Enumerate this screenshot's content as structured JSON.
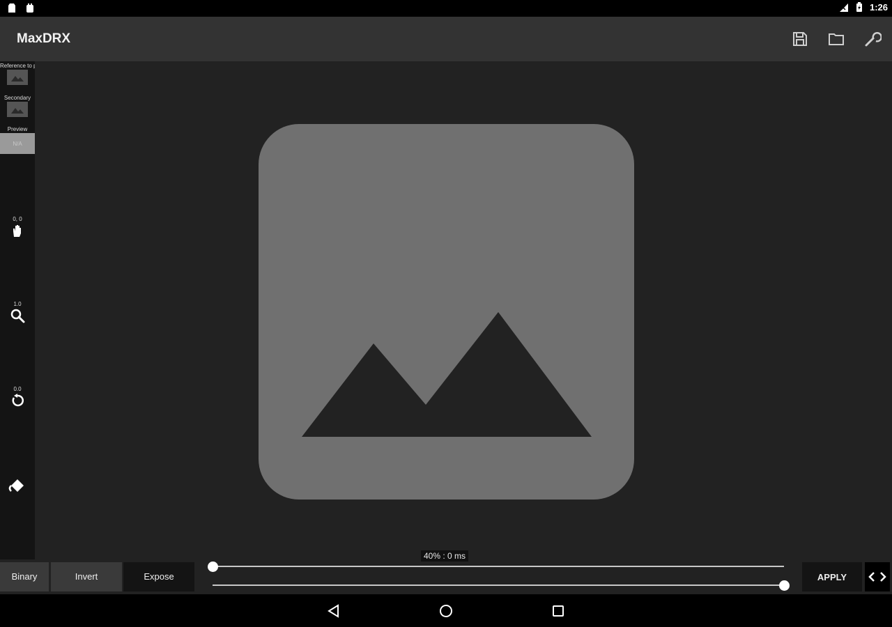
{
  "status_bar": {
    "time": "1:26",
    "icons": [
      "notification-icon",
      "android-icon",
      "signal-icon",
      "battery-icon"
    ]
  },
  "app_bar": {
    "title": "MaxDRX",
    "actions": [
      "save-icon",
      "folder-icon",
      "wrench-icon"
    ]
  },
  "left_rail": {
    "layers": [
      {
        "label": "Reference to primary"
      },
      {
        "label": "Secondary"
      },
      {
        "label": "Preview",
        "thumb_text": "N/A"
      }
    ],
    "tools": [
      {
        "icon": "hand-icon",
        "value": "0, 0"
      },
      {
        "icon": "zoom-icon",
        "value": "1.0"
      },
      {
        "icon": "rotate-icon",
        "value": "0.0"
      },
      {
        "icon": "fill-icon",
        "value": ""
      }
    ]
  },
  "canvas": {
    "placeholder_icon": "image-placeholder-icon",
    "colors": {
      "background": "#222222",
      "placeholder": "#707070"
    }
  },
  "controls": {
    "modes": [
      "Binary",
      "Invert",
      "Expose"
    ],
    "slider_label": "40% : 0 ms",
    "slider_top_value": 0,
    "slider_bottom_value": 1,
    "apply_label": "APPLY",
    "nav_arrows": "‹›"
  },
  "nav_bar": {
    "icons": [
      "back-icon",
      "home-icon",
      "recents-icon"
    ]
  }
}
